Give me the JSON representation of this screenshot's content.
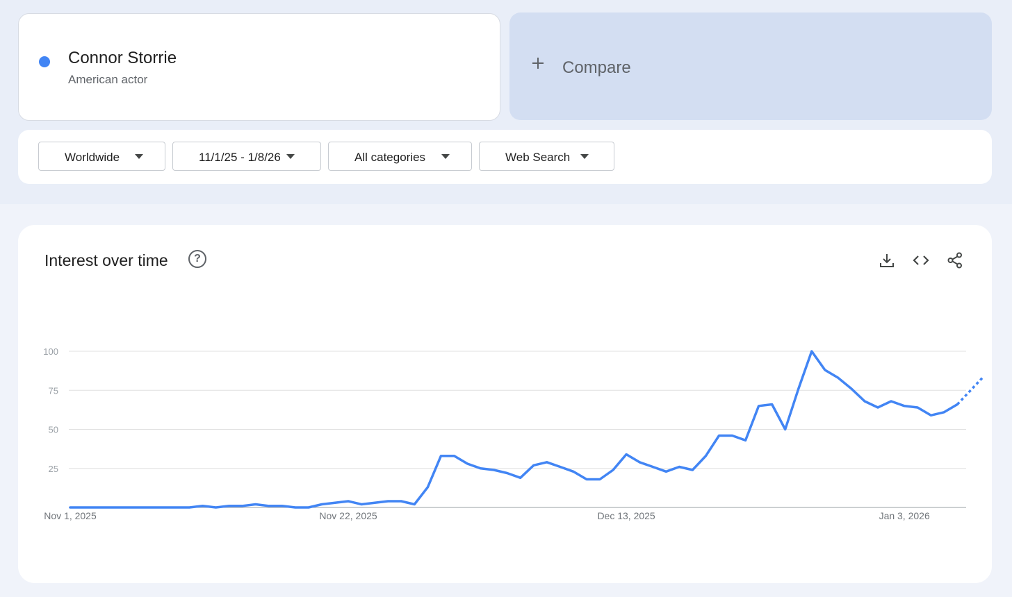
{
  "term": {
    "name": "Connor Storrie",
    "description": "American actor",
    "dot_color": "#4285f4"
  },
  "compare": {
    "label": "Compare",
    "icon": "plus-icon"
  },
  "filters": [
    {
      "label": "Worldwide",
      "icon": "caret-down-icon"
    },
    {
      "label": "11/1/25 - 1/8/26",
      "icon": "caret-down-icon"
    },
    {
      "label": "All categories",
      "icon": "caret-down-icon"
    },
    {
      "label": "Web Search",
      "icon": "caret-down-icon"
    }
  ],
  "panel": {
    "title": "Interest over time",
    "help_icon": "help-circle-icon",
    "help_glyph": "?",
    "actions": [
      "download-icon",
      "embed-code-icon",
      "share-icon"
    ]
  },
  "chart_data": {
    "type": "line",
    "x_tick_labels": [
      "Nov 1, 2025",
      "Nov 22, 2025",
      "Dec 13, 2025",
      "Jan 3, 2026"
    ],
    "y_ticks": [
      25,
      50,
      75,
      100
    ],
    "ylim": [
      0,
      100
    ],
    "grid": true,
    "line_color": "#4285f4",
    "series": [
      {
        "values": [
          0,
          0,
          0,
          0,
          0,
          0,
          0,
          0,
          0,
          0,
          1,
          0,
          1,
          1,
          2,
          1,
          1,
          0,
          0,
          2,
          3,
          4,
          2,
          3,
          4,
          4,
          2,
          13,
          33,
          33,
          28,
          25,
          24,
          22,
          19,
          27,
          29,
          26,
          23,
          18,
          18,
          24,
          34,
          29,
          26,
          23,
          26,
          24,
          33,
          46,
          46,
          43,
          65,
          66,
          50,
          76,
          100,
          88,
          83,
          76,
          68,
          64,
          68,
          65,
          64,
          59,
          61,
          66
        ],
        "partial_values": [
          66,
          75,
          84
        ]
      }
    ]
  }
}
